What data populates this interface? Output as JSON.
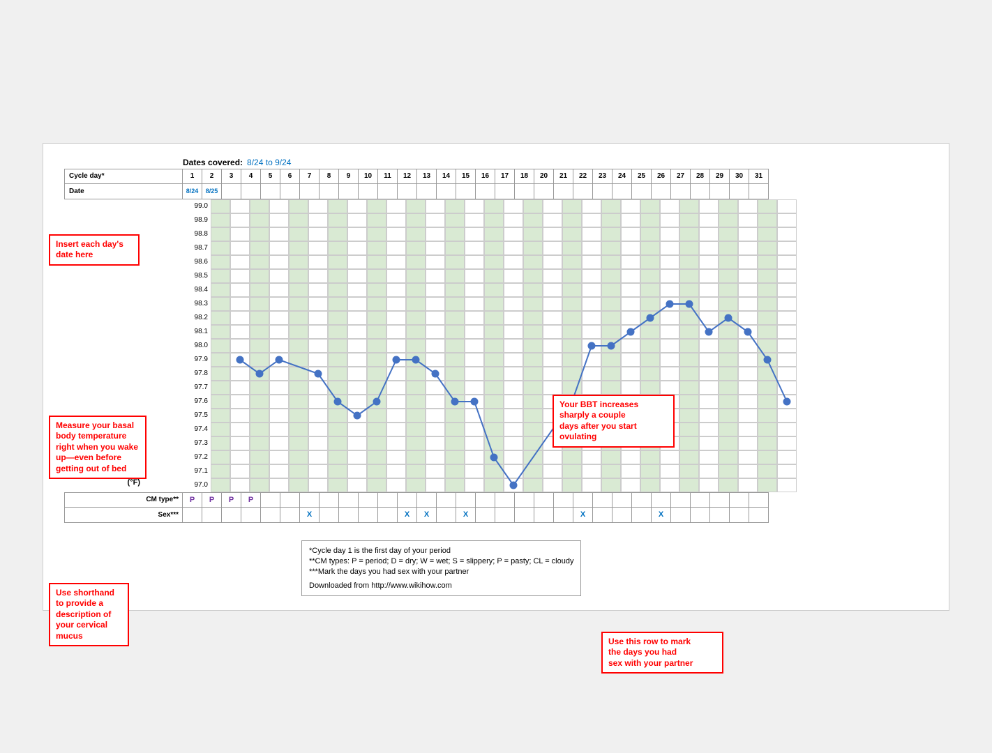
{
  "header": {
    "dates_label": "Dates covered:",
    "dates_value": "8/24 to 9/24"
  },
  "cycle_days": [
    1,
    2,
    3,
    4,
    5,
    6,
    7,
    8,
    9,
    10,
    11,
    12,
    13,
    14,
    15,
    16,
    17,
    18,
    20,
    21,
    22,
    23,
    24,
    25,
    26,
    27,
    28,
    29,
    30,
    31
  ],
  "dates": [
    "8/24",
    "8/25",
    "",
    "",
    "",
    "",
    "",
    "",
    "",
    "",
    "",
    "",
    "",
    "",
    "",
    "",
    "",
    "",
    "",
    "",
    "",
    "",
    "",
    "",
    "",
    "",
    "",
    "",
    "",
    ""
  ],
  "temps": {
    "min": 97.0,
    "max": 99.0,
    "step": 0.1,
    "values": [
      null,
      97.9,
      97.8,
      97.9,
      null,
      97.8,
      97.6,
      97.5,
      97.6,
      97.9,
      97.9,
      97.8,
      97.6,
      97.6,
      97.2,
      97.0,
      null,
      null,
      97.6,
      98.0,
      98.0,
      98.1,
      98.2,
      98.3,
      98.3,
      98.1,
      98.2,
      98.1,
      97.9,
      97.6
    ]
  },
  "cm_type": {
    "label": "CM type**",
    "values": [
      "P",
      "P",
      "P",
      "P",
      "",
      "",
      "",
      "",
      "",
      "",
      "",
      "",
      "",
      "",
      "",
      "",
      "",
      "",
      "",
      "",
      "",
      "",
      "",
      "",
      "",
      "",
      "",
      "",
      "",
      ""
    ]
  },
  "sex_row": {
    "label": "Sex***",
    "values": [
      "",
      "",
      "",
      "",
      "",
      "",
      "X",
      "",
      "",
      "",
      "",
      "X",
      "X",
      "",
      "X",
      "",
      "",
      "",
      "",
      "",
      "X",
      "",
      "",
      "",
      "X",
      "",
      "",
      "",
      "",
      ""
    ]
  },
  "footnotes": [
    "*Cycle day 1 is the first day of your period",
    "**CM types: P = period; D = dry; W = wet; S = slippery; P = pasty; CL = cloudy",
    "***Mark the days you had sex with your partner"
  ],
  "download_text": "Downloaded from http://www.wikihow.com",
  "annotations": {
    "insert_date": "Insert each day's\ndate here",
    "measure_bbt": "Measure your basal\nbody temperature\nright when you wake\nup—even before\ngetting out of bed",
    "cervical_mucus": "Use shorthand\nto provide a\ndescription of\nyour cervical\nmucus",
    "bbt_increases": "Your BBT increases\nsharply a couple\ndays after you start\novulating",
    "sex_row": "Use this row to mark\nthe days you had\nsex with your partner"
  },
  "colors": {
    "red": "#cc0000",
    "blue": "#4472c4",
    "green_bg": "#d9ead3",
    "header_blue": "#0070c0"
  }
}
